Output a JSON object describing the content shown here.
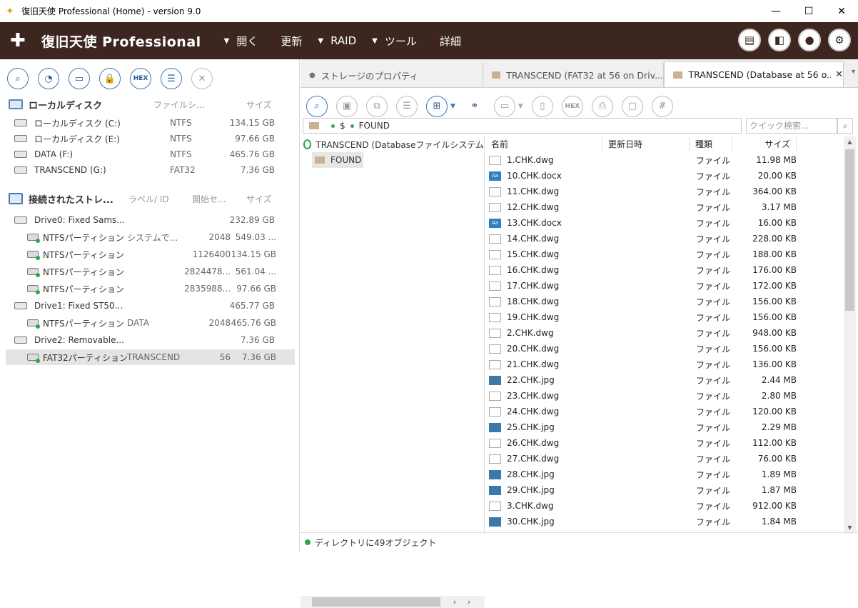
{
  "window": {
    "title": "復旧天使 Professional (Home) - version 9.0",
    "minimize": "—",
    "maximize": "☐",
    "close": "✕"
  },
  "app": {
    "logo_text": "復旧天使 Professional",
    "menu": [
      {
        "label": "開く",
        "arrow": "▼"
      },
      {
        "label": "更新",
        "arrow": ""
      },
      {
        "label": "RAID",
        "arrow": "▼"
      },
      {
        "label": "ツール",
        "arrow": "▼"
      },
      {
        "label": "詳細",
        "arrow": ""
      }
    ]
  },
  "left": {
    "toolbar": {
      "hex": "HEX"
    },
    "local": {
      "title": "ローカルディスク",
      "col_fs": "ファイルシ...",
      "col_size": "サイズ",
      "disks": [
        {
          "name": "ローカルディスク (C:)",
          "fs": "NTFS",
          "size": "134.15 GB"
        },
        {
          "name": "ローカルディスク (E:)",
          "fs": "NTFS",
          "size": "97.66 GB"
        },
        {
          "name": "DATA (F:)",
          "fs": "NTFS",
          "size": "465.76 GB"
        },
        {
          "name": "TRANSCEND (G:)",
          "fs": "FAT32",
          "size": "7.36 GB"
        }
      ]
    },
    "storage": {
      "title": "接続されたストレ...",
      "col_label": "ラベル/ ID",
      "col_start": "開始セ...",
      "col_size": "サイズ",
      "drives": [
        {
          "name": "Drive0: Fixed Sams...",
          "size": "232.89 GB",
          "parts": [
            {
              "name": "NTFSパーティション",
              "label": "システムで...",
              "start": "2048",
              "size": "549.03 ..."
            },
            {
              "name": "NTFSパーティション",
              "label": "",
              "start": "1126400",
              "size": "134.15 GB"
            },
            {
              "name": "NTFSパーティション",
              "label": "",
              "start": "2824478...",
              "size": "561.04 ..."
            },
            {
              "name": "NTFSパーティション",
              "label": "",
              "start": "2835988...",
              "size": "97.66 GB"
            }
          ]
        },
        {
          "name": "Drive1: Fixed ST50...",
          "size": "465.77 GB",
          "parts": [
            {
              "name": "NTFSパーティション",
              "label": "DATA",
              "start": "2048",
              "size": "465.76 GB"
            }
          ]
        },
        {
          "name": "Drive2: Removable...",
          "size": "7.36 GB",
          "parts": [
            {
              "name": "FAT32パーティション",
              "label": "TRANSCEND",
              "start": "56",
              "size": "7.36 GB"
            }
          ]
        }
      ]
    }
  },
  "right": {
    "tabs": [
      {
        "label": "ストレージのプロパティ"
      },
      {
        "label": "TRANSCEND (FAT32 at 56 on Driv..."
      },
      {
        "label": "TRANSCEND (Database at 56 o..."
      }
    ],
    "toolbar": {
      "hex": "HEX",
      "hash": "#"
    },
    "path": {
      "root": "$",
      "folder": "FOUND"
    },
    "search_placeholder": "クイック検索...",
    "tree": {
      "root": "TRANSCEND (Databaseファイルシステム",
      "child": "FOUND"
    },
    "columns": {
      "name": "名前",
      "date": "更新日時",
      "type": "種類",
      "size": "サイズ"
    },
    "files": [
      {
        "name": "1.CHK.dwg",
        "type": "ファイル",
        "size": "11.98 MB",
        "icon": "dwg"
      },
      {
        "name": "10.CHK.docx",
        "type": "ファイル",
        "size": "20.00 KB",
        "icon": "docx"
      },
      {
        "name": "11.CHK.dwg",
        "type": "ファイル",
        "size": "364.00 KB",
        "icon": "dwg"
      },
      {
        "name": "12.CHK.dwg",
        "type": "ファイル",
        "size": "3.17 MB",
        "icon": "dwg"
      },
      {
        "name": "13.CHK.docx",
        "type": "ファイル",
        "size": "16.00 KB",
        "icon": "docx"
      },
      {
        "name": "14.CHK.dwg",
        "type": "ファイル",
        "size": "228.00 KB",
        "icon": "dwg"
      },
      {
        "name": "15.CHK.dwg",
        "type": "ファイル",
        "size": "188.00 KB",
        "icon": "dwg"
      },
      {
        "name": "16.CHK.dwg",
        "type": "ファイル",
        "size": "176.00 KB",
        "icon": "dwg"
      },
      {
        "name": "17.CHK.dwg",
        "type": "ファイル",
        "size": "172.00 KB",
        "icon": "dwg"
      },
      {
        "name": "18.CHK.dwg",
        "type": "ファイル",
        "size": "156.00 KB",
        "icon": "dwg"
      },
      {
        "name": "19.CHK.dwg",
        "type": "ファイル",
        "size": "156.00 KB",
        "icon": "dwg"
      },
      {
        "name": "2.CHK.dwg",
        "type": "ファイル",
        "size": "948.00 KB",
        "icon": "dwg"
      },
      {
        "name": "20.CHK.dwg",
        "type": "ファイル",
        "size": "156.00 KB",
        "icon": "dwg"
      },
      {
        "name": "21.CHK.dwg",
        "type": "ファイル",
        "size": "136.00 KB",
        "icon": "dwg"
      },
      {
        "name": "22.CHK.jpg",
        "type": "ファイル",
        "size": "2.44 MB",
        "icon": "jpg"
      },
      {
        "name": "23.CHK.dwg",
        "type": "ファイル",
        "size": "2.80 MB",
        "icon": "dwg"
      },
      {
        "name": "24.CHK.dwg",
        "type": "ファイル",
        "size": "120.00 KB",
        "icon": "dwg"
      },
      {
        "name": "25.CHK.jpg",
        "type": "ファイル",
        "size": "2.29 MB",
        "icon": "jpg"
      },
      {
        "name": "26.CHK.dwg",
        "type": "ファイル",
        "size": "112.00 KB",
        "icon": "dwg"
      },
      {
        "name": "27.CHK.dwg",
        "type": "ファイル",
        "size": "76.00 KB",
        "icon": "dwg"
      },
      {
        "name": "28.CHK.jpg",
        "type": "ファイル",
        "size": "1.89 MB",
        "icon": "jpg"
      },
      {
        "name": "29.CHK.jpg",
        "type": "ファイル",
        "size": "1.87 MB",
        "icon": "jpg"
      },
      {
        "name": "3.CHK.dwg",
        "type": "ファイル",
        "size": "912.00 KB",
        "icon": "dwg"
      },
      {
        "name": "30.CHK.jpg",
        "type": "ファイル",
        "size": "1.84 MB",
        "icon": "jpg"
      }
    ],
    "status": "ディレクトリに49オブジェクト"
  }
}
